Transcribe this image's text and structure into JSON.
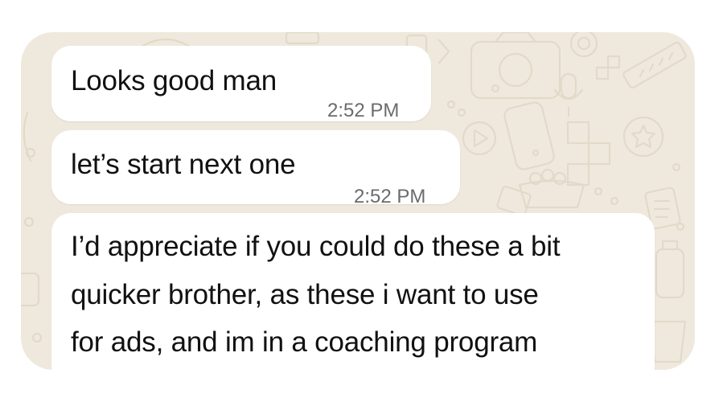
{
  "chat": {
    "background_color": "#efe9dd",
    "bubble_color": "#ffffff",
    "wallpaper_icons": [
      "camera-icon",
      "phone-icon",
      "play-icon",
      "microphone-icon",
      "puzzle-icon",
      "star-icon",
      "gift-icon",
      "ruler-icon",
      "fruit-basket-icon",
      "note-icon"
    ],
    "messages": [
      {
        "text": "Looks good man",
        "time": "2:52 PM"
      },
      {
        "text": "let’s start next one",
        "time": "2:52 PM"
      },
      {
        "lines": [
          "I’d appreciate if you could do these a bit",
          "quicker brother, as these i want to use",
          "for ads, and im in a coaching program"
        ]
      }
    ]
  }
}
